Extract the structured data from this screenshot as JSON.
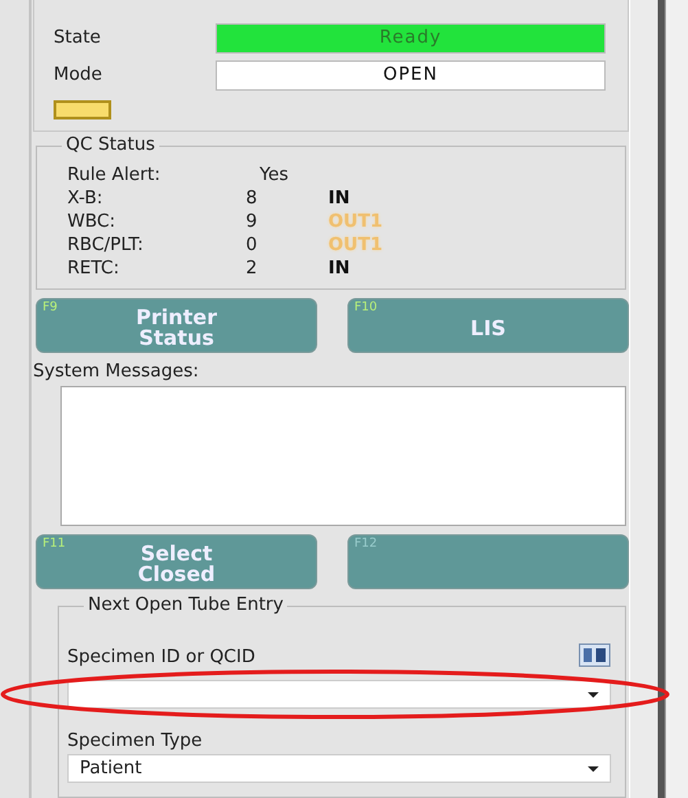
{
  "status_fields": [
    {
      "label": "State",
      "value": "Ready",
      "color": "#22e33c"
    },
    {
      "label": "Mode",
      "value": "OPEN",
      "color": "#ffffff"
    }
  ],
  "qc_status": {
    "title": "QC Status",
    "rule_alert": {
      "label": "Rule Alert:",
      "value": "Yes"
    },
    "rows": [
      {
        "name": "X-B:",
        "count": "8",
        "result": "IN",
        "kind": "in"
      },
      {
        "name": "WBC:",
        "count": "9",
        "result": "OUT1",
        "kind": "out"
      },
      {
        "name": "RBC/PLT:",
        "count": "0",
        "result": "OUT1",
        "kind": "out"
      },
      {
        "name": "RETC:",
        "count": "2",
        "result": "IN",
        "kind": "in"
      }
    ]
  },
  "buttons_top": [
    {
      "key": "F9",
      "label": "Printer Status",
      "disabled": false
    },
    {
      "key": "F10",
      "label": "LIS",
      "disabled": false
    }
  ],
  "system_messages": {
    "label": "System Messages:"
  },
  "buttons_bottom": [
    {
      "key": "F11",
      "label": "Select Closed",
      "disabled": false
    },
    {
      "key": "F12",
      "disabled": true
    }
  ],
  "next_entry": {
    "title": "Next Open Tube Entry",
    "specimen_id_label": "Specimen ID or QCID",
    "specimen_type_label": "Specimen Type",
    "specimen_type_value": "Patient"
  },
  "annotation": {
    "kind": "ellipse"
  }
}
